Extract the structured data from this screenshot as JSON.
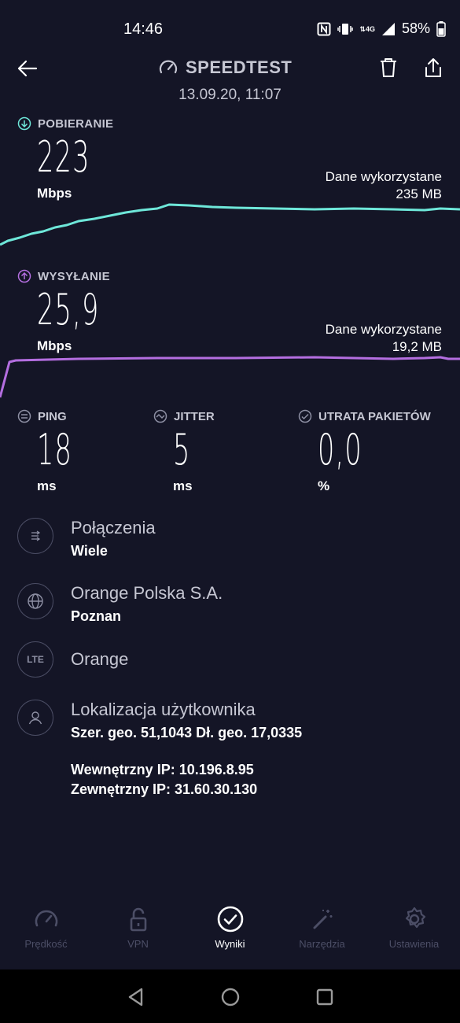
{
  "status": {
    "time": "14:46",
    "battery": "58%",
    "network": "4G"
  },
  "header": {
    "title": "SPEEDTEST",
    "date": "13.09.20, 11:07"
  },
  "download": {
    "label": "POBIERANIE",
    "value": "223",
    "unit": "Mbps",
    "data_used_label": "Dane wykorzystane",
    "data_used_value": "235 MB",
    "color": "#6ee7d9"
  },
  "upload": {
    "label": "WYSYŁANIE",
    "value": "25,9",
    "unit": "Mbps",
    "data_used_label": "Dane wykorzystane",
    "data_used_value": "19,2 MB",
    "color": "#b46ee0"
  },
  "metrics": [
    {
      "label": "PING",
      "value": "18",
      "unit": "ms"
    },
    {
      "label": "JITTER",
      "value": "5",
      "unit": "ms"
    },
    {
      "label": "UTRATA PAKIETÓW",
      "value": "0,0",
      "unit": "%"
    }
  ],
  "info": {
    "connections": {
      "title": "Połączenia",
      "sub": "Wiele"
    },
    "provider": {
      "title": "Orange Polska S.A.",
      "sub": "Poznan"
    },
    "network": {
      "icon_text": "LTE",
      "title": "Orange"
    },
    "location": {
      "title": "Lokalizacja użytkownika",
      "sub": "Szer. geo. 51,1043 Dł. geo. 17,0335"
    },
    "internal_ip": "Wewnętrzny IP: 10.196.8.95",
    "external_ip": "Zewnętrzny IP: 31.60.30.130"
  },
  "nav": [
    {
      "label": "Prędkość",
      "icon": "speedometer-icon"
    },
    {
      "label": "VPN",
      "icon": "lock-icon"
    },
    {
      "label": "Wyniki",
      "icon": "check-circle-icon",
      "active": true
    },
    {
      "label": "Narzędzia",
      "icon": "magic-wand-icon"
    },
    {
      "label": "Ustawienia",
      "icon": "gear-icon"
    }
  ]
}
